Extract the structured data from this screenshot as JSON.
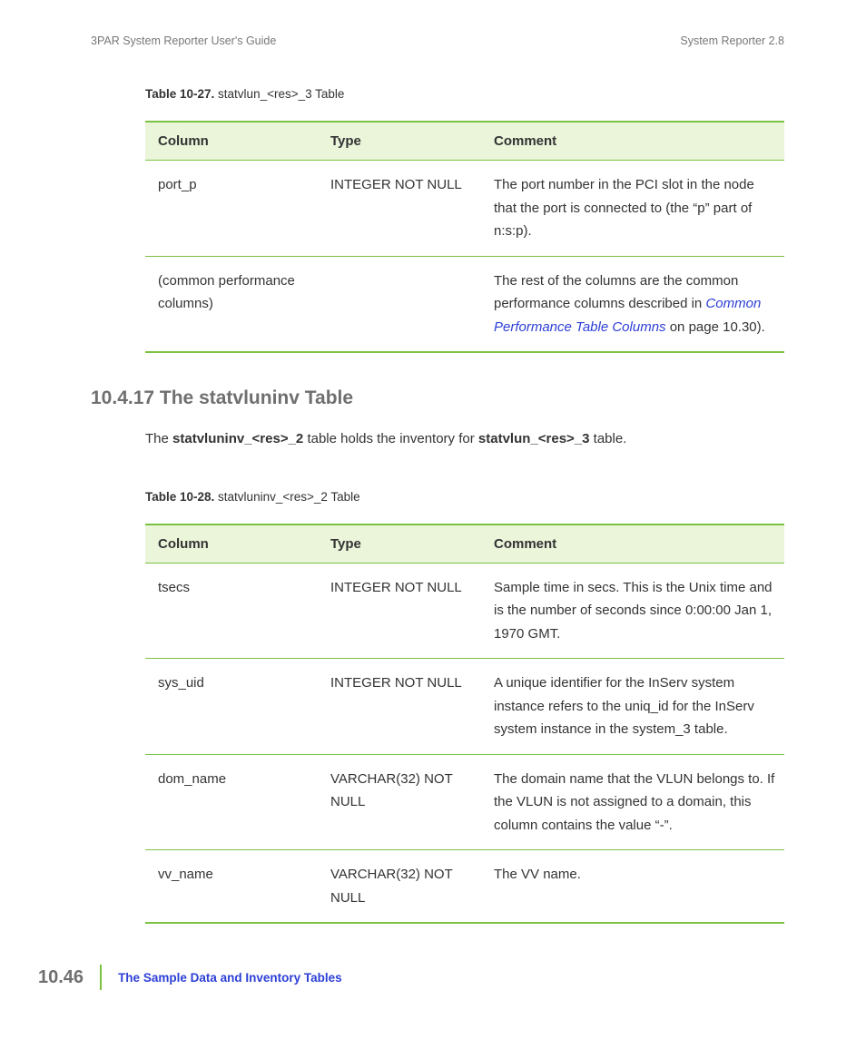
{
  "header": {
    "left": "3PAR System Reporter User's Guide",
    "right": "System Reporter 2.8"
  },
  "table27": {
    "caption_label": "Table 10-27.",
    "caption_text": " statvlun_<res>_3 Table",
    "head": {
      "c1": "Column",
      "c2": "Type",
      "c3": "Comment"
    },
    "rows": [
      {
        "c1": "port_p",
        "c2": "INTEGER NOT NULL",
        "c3": "The port number in the PCI slot in the node that the port is connected to (the “p” part of n:s:p)."
      },
      {
        "c1": "(common performance columns)",
        "c2": "",
        "c3_pre": "The rest of the columns are the common performance columns described in ",
        "c3_link": "Common Performance Table Columns",
        "c3_post": " on page 10.30)."
      }
    ]
  },
  "section_heading": "10.4.17 The statvluninv Table",
  "intro": {
    "t1": "The ",
    "b1": "statvluninv_<res>_2",
    "t2": " table holds the inventory for ",
    "b2": "statvlun_<res>_3",
    "t3": " table."
  },
  "table28": {
    "caption_label": "Table 10-28.",
    "caption_text": " statvluninv_<res>_2 Table",
    "head": {
      "c1": "Column",
      "c2": "Type",
      "c3": "Comment"
    },
    "rows": [
      {
        "c1": "tsecs",
        "c2": "INTEGER NOT NULL",
        "c3": "Sample time in secs. This is the Unix time and is the number of seconds since 0:00:00 Jan 1, 1970 GMT."
      },
      {
        "c1": "sys_uid",
        "c2": "INTEGER NOT NULL",
        "c3": "A unique identifier for the InServ system instance refers to the uniq_id for the InServ system instance in the system_3 table."
      },
      {
        "c1": "dom_name",
        "c2": "VARCHAR(32) NOT NULL",
        "c3": "The domain name that the VLUN belongs to. If the VLUN is not assigned to a domain, this column contains the value “-”."
      },
      {
        "c1": "vv_name",
        "c2": "VARCHAR(32) NOT NULL",
        "c3": "The VV name."
      }
    ]
  },
  "footer": {
    "page": "10.46",
    "section": "The Sample Data and Inventory Tables"
  }
}
